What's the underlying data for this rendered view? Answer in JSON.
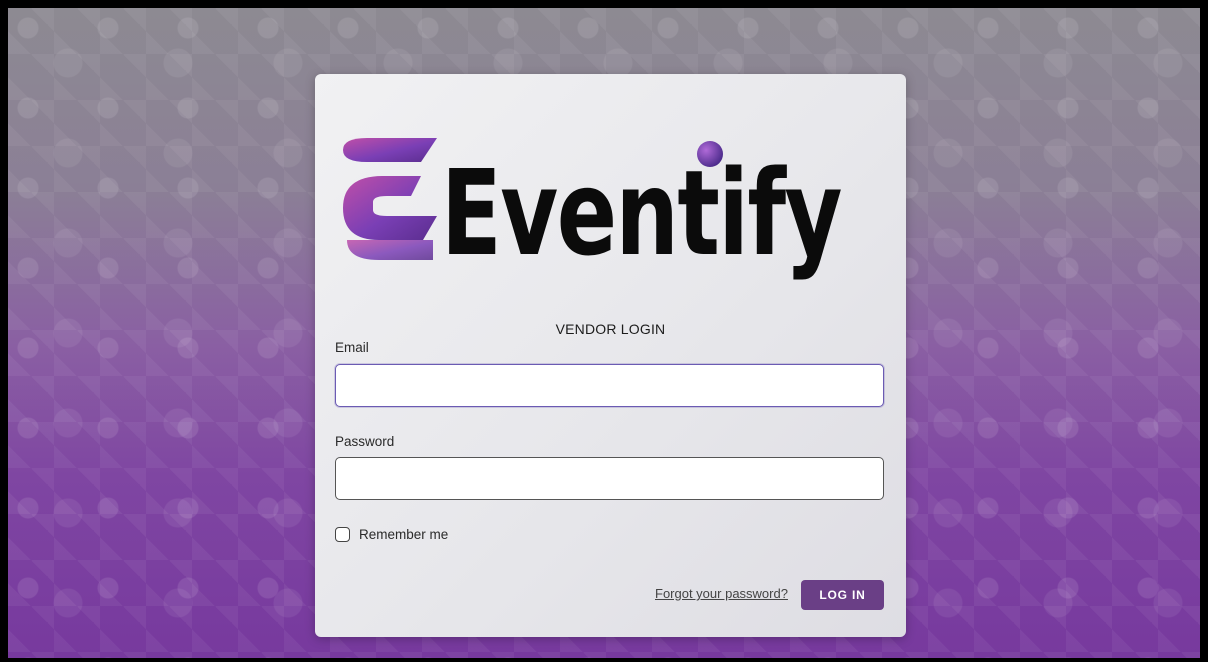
{
  "logo": {
    "text": "Eventify",
    "icon": "stylized-e-icon",
    "accent_colors": [
      "#c04fa8",
      "#7a3fb5",
      "#5a2d8e"
    ]
  },
  "form": {
    "title": "VENDOR LOGIN",
    "email_label": "Email",
    "email_value": "",
    "password_label": "Password",
    "password_value": "",
    "remember_label": "Remember me",
    "remember_checked": false,
    "forgot_link": "Forgot your password?",
    "login_button": "LOG IN"
  },
  "colors": {
    "button": "#6a3f86",
    "background_gradient_end": "#77399e"
  }
}
